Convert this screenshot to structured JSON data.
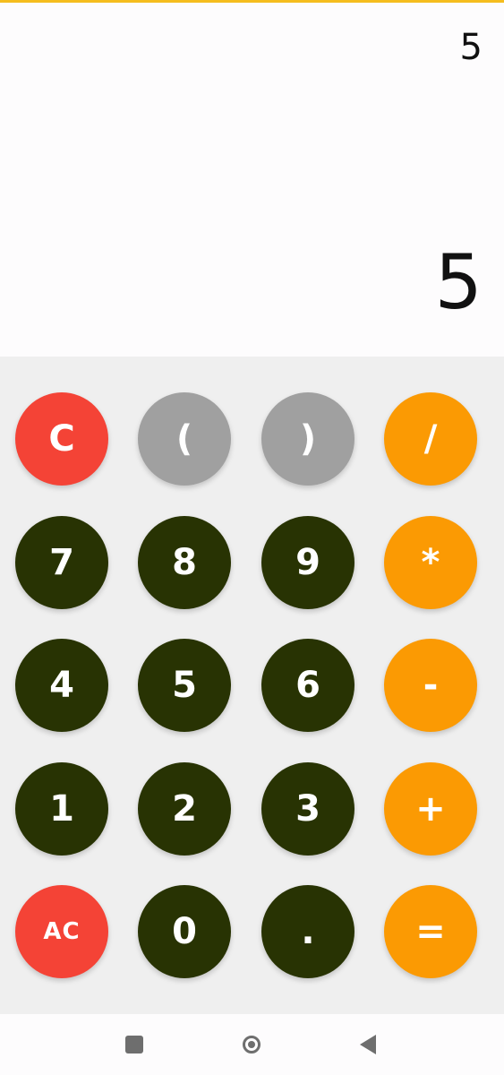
{
  "display": {
    "expression": "5",
    "result": "5"
  },
  "keypad": {
    "rows": [
      [
        "C",
        "(",
        ")",
        "/"
      ],
      [
        "7",
        "8",
        "9",
        "*"
      ],
      [
        "4",
        "5",
        "6",
        "-"
      ],
      [
        "1",
        "2",
        "3",
        "+"
      ],
      [
        "AC",
        "0",
        ".",
        "="
      ]
    ]
  },
  "colors": {
    "accent_bar": "#f5bd1e",
    "clear_keys": "#f44336",
    "paren_keys": "#a0a0a0",
    "operator_keys": "#fb9a03",
    "digit_keys": "#283303"
  },
  "navigation": {
    "recents_icon": "square-icon",
    "home_icon": "circle-icon",
    "back_icon": "triangle-back-icon"
  }
}
